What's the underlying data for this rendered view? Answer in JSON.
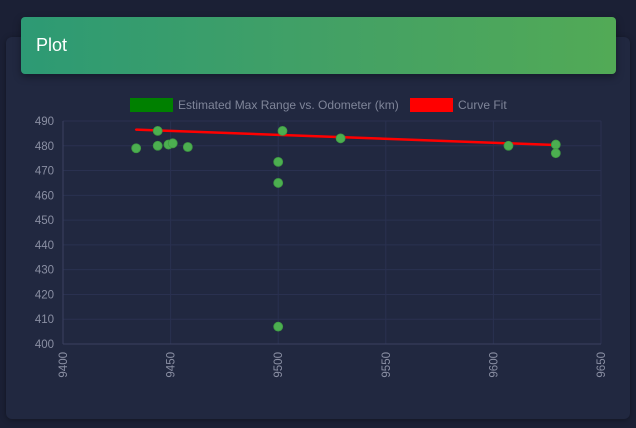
{
  "header": {
    "title": "Plot",
    "background_from": "#2d9a74",
    "background_to": "#52aa56"
  },
  "chart_data": {
    "type": "scatter",
    "title": "",
    "xlabel": "",
    "ylabel": "",
    "xlim": [
      9400,
      9650
    ],
    "ylim": [
      400,
      490
    ],
    "x_ticks": [
      9400,
      9450,
      9500,
      9550,
      9600,
      9650
    ],
    "y_ticks": [
      400,
      410,
      420,
      430,
      440,
      450,
      460,
      470,
      480,
      490
    ],
    "grid": true,
    "legend_position": "top",
    "series": [
      {
        "name": "Estimated Max Range vs. Odometer (km)",
        "kind": "scatter",
        "legend_color": "#008000",
        "point_color": "#4caf50",
        "points": [
          {
            "x": 9434,
            "y": 479
          },
          {
            "x": 9444,
            "y": 486
          },
          {
            "x": 9444,
            "y": 480
          },
          {
            "x": 9449,
            "y": 480.5
          },
          {
            "x": 9451,
            "y": 481
          },
          {
            "x": 9458,
            "y": 479.5
          },
          {
            "x": 9500,
            "y": 473.5
          },
          {
            "x": 9500,
            "y": 465
          },
          {
            "x": 9500,
            "y": 407
          },
          {
            "x": 9502,
            "y": 486
          },
          {
            "x": 9529,
            "y": 483
          },
          {
            "x": 9607,
            "y": 480
          },
          {
            "x": 9629,
            "y": 480.5
          },
          {
            "x": 9629,
            "y": 477
          }
        ]
      },
      {
        "name": "Curve Fit",
        "kind": "line",
        "color": "#ff0000",
        "points": [
          {
            "x": 9434,
            "y": 486.5
          },
          {
            "x": 9629,
            "y": 480.3
          }
        ]
      }
    ]
  }
}
